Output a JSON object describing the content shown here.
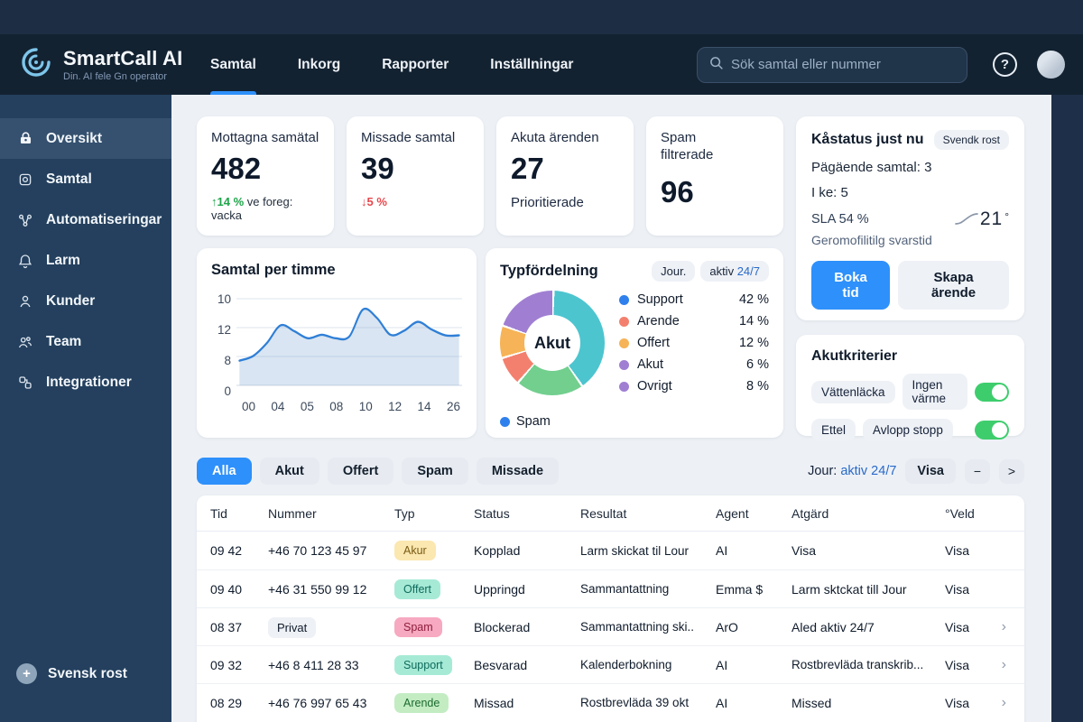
{
  "topbar": {
    "logo_title": "SmartCall AI",
    "logo_tagline": "Din. AI fele Gn operator",
    "nav": [
      {
        "label": "Samtal",
        "active": true
      },
      {
        "label": "Inkorg",
        "active": false
      },
      {
        "label": "Rapporter",
        "active": false
      },
      {
        "label": "Inställningar",
        "active": false
      }
    ],
    "search_placeholder": "Sök samtal eller nummer",
    "help_label": "?"
  },
  "sidebar": {
    "items": [
      {
        "label": "Oversikt",
        "icon": "lock-icon",
        "active": true
      },
      {
        "label": "Samtal",
        "icon": "call-icon",
        "active": false
      },
      {
        "label": "Automatiseringar",
        "icon": "automation-icon",
        "active": false
      },
      {
        "label": "Larm",
        "icon": "bell-icon",
        "active": false
      },
      {
        "label": "Kunder",
        "icon": "person-icon",
        "active": false
      },
      {
        "label": "Team",
        "icon": "team-icon",
        "active": false
      },
      {
        "label": "Integrationer",
        "icon": "integration-icon",
        "active": false
      }
    ],
    "footer": {
      "label": "Svensk rost",
      "icon": "plus-circle-icon"
    }
  },
  "kpis": [
    {
      "label": "Mottagna samätal",
      "value": "482",
      "trend": "↑14 %",
      "trend_note": " ve foreg: vacka"
    },
    {
      "label": "Missade samtal",
      "value": "39",
      "trend": "↓5 %",
      "trend_note": ""
    },
    {
      "label": "Akuta ärenden",
      "value": "27",
      "note": "Prioritierade"
    },
    {
      "label": "Spam filtrerade",
      "value": "96"
    }
  ],
  "status_card": {
    "title": "Kåstatus just nu",
    "badge": "Svendk rost",
    "line1": "Pägäende samtal: 3",
    "line2": "I ke: 5",
    "sla_label": "SLA 54 %",
    "sla_value": "21",
    "sla_degree": "°",
    "sla_sub": "Geromofilitilg svarstid",
    "primary_button": "Boka tid",
    "secondary_button": "Skapa ärende"
  },
  "akutkriterier": {
    "title": "Akutkriterier",
    "rows": [
      {
        "chips": [
          "Vättenläcka",
          "Ingen värme"
        ],
        "toggle_on": true
      },
      {
        "chips": [
          "Ettel",
          "Avlopp stopp"
        ],
        "toggle_on": true
      }
    ]
  },
  "hour_chart": {
    "type": "line",
    "title": "Samtal per timme",
    "x_labels": [
      "00",
      "04",
      "05",
      "08",
      "10",
      "12",
      "14",
      "26"
    ],
    "y_ticks": [
      "10",
      "12",
      "8",
      "0"
    ],
    "values": [
      4.2,
      5.0,
      7.2,
      10.2,
      9.2,
      8.0,
      8.6,
      8.0,
      8.3,
      12.9,
      11.5,
      8.6,
      9.3,
      10.8,
      9.5,
      8.5,
      8.5
    ],
    "ymax": 13.5,
    "line_color": "#2f7fd6",
    "fill_color": "rgba(120,160,210,0.28)"
  },
  "type_chart": {
    "type": "donut",
    "title": "Typfördelning",
    "pill1": "Jour.",
    "pill2_prefix": "aktiv ",
    "pill2_value": "24/7",
    "center_label": "Akut",
    "segments": [
      {
        "name": "support",
        "value": 40,
        "color": "#4cc5cf"
      },
      {
        "name": "arende",
        "value": 21,
        "color": "#72cf8e"
      },
      {
        "name": "offert",
        "value": 9,
        "color": "#f3806e"
      },
      {
        "name": "akut",
        "value": 10,
        "color": "#f6b357"
      },
      {
        "name": "ovrigt",
        "value": 20,
        "color": "#a07fd2"
      }
    ],
    "legend": [
      {
        "label": "Support",
        "value": "42 %",
        "dot": "#2f80ed"
      },
      {
        "label": "Arende",
        "value": "14 %",
        "dot": "#f3806e"
      },
      {
        "label": "Offert",
        "value": "12 %",
        "dot": "#f6b357"
      },
      {
        "label": "Akut",
        "value": "6 %",
        "dot": "#a07fd2"
      },
      {
        "label": "Ovrigt",
        "value": "8 %",
        "dot": "#a07fd2"
      }
    ],
    "footer_legend": {
      "label": "Spam",
      "dot": "#2f80ed"
    }
  },
  "filterbar": {
    "tabs": [
      {
        "label": "Alla",
        "active": true
      },
      {
        "label": "Akut",
        "active": false
      },
      {
        "label": "Offert",
        "active": false
      },
      {
        "label": "Spam",
        "active": false
      },
      {
        "label": "Missade",
        "active": false
      }
    ],
    "jour_label": "Jour: ",
    "jour_value": "aktiv 24/7",
    "visa_button": "Visa",
    "minus_button": "−",
    "next_button": ">"
  },
  "table": {
    "headers": [
      "Tid",
      "Nummer",
      "Typ",
      "Status",
      "Resultat",
      "Agent",
      "Atgärd",
      "°Veld"
    ],
    "rows": [
      {
        "tid": "09 42",
        "nummer": "+46 70 123 45 97",
        "nummer_badge": false,
        "typ": "Akur",
        "typ_bg": "#fbe7b0",
        "typ_color": "#7a5b14",
        "status": "Kopplad",
        "resultat": "Larm skickat til Lour",
        "agent": "AI",
        "atgard": "Visa",
        "veld": "Visa",
        "chevron": ""
      },
      {
        "tid": "09 40",
        "nummer": "+46 31 550 99 12",
        "nummer_badge": false,
        "typ": "Offert",
        "typ_bg": "#a6ead6",
        "typ_color": "#0f6b5c",
        "status": "Uppringd",
        "resultat": "Sammantattning",
        "agent": "Emma $",
        "atgard": "Larm sktckat till Jour",
        "veld": "Visa",
        "chevron": ""
      },
      {
        "tid": "08 37",
        "nummer": "Privat",
        "nummer_badge": true,
        "typ": "Spam",
        "typ_bg": "#f6a9c0",
        "typ_color": "#8f1d3f",
        "status": "Blockerad",
        "resultat": "Sammantattning ski..",
        "agent": "ArO",
        "atgard": "Aled aktiv 24/7",
        "veld": "Visa",
        "chevron": "›"
      },
      {
        "tid": "09 32",
        "nummer": "+46 8 411 28 33",
        "nummer_badge": false,
        "typ": "Support",
        "typ_bg": "#a6ead6",
        "typ_color": "#0f6b5c",
        "status": "Besvarad",
        "resultat": "Kalenderbokning",
        "agent": "AI",
        "atgard": "Rostbrevläda transkrib...",
        "veld": "Visa",
        "chevron": "›"
      },
      {
        "tid": "08 29",
        "nummer": "+46 76 997 65 43",
        "nummer_badge": false,
        "typ": "Arende",
        "typ_bg": "#c3ecc3",
        "typ_color": "#1c6b2f",
        "status": "Missad",
        "resultat": "Rostbrevläda 39 okt",
        "agent": "AI",
        "atgard": "Missed",
        "veld": "Visa",
        "chevron": "›"
      }
    ]
  }
}
